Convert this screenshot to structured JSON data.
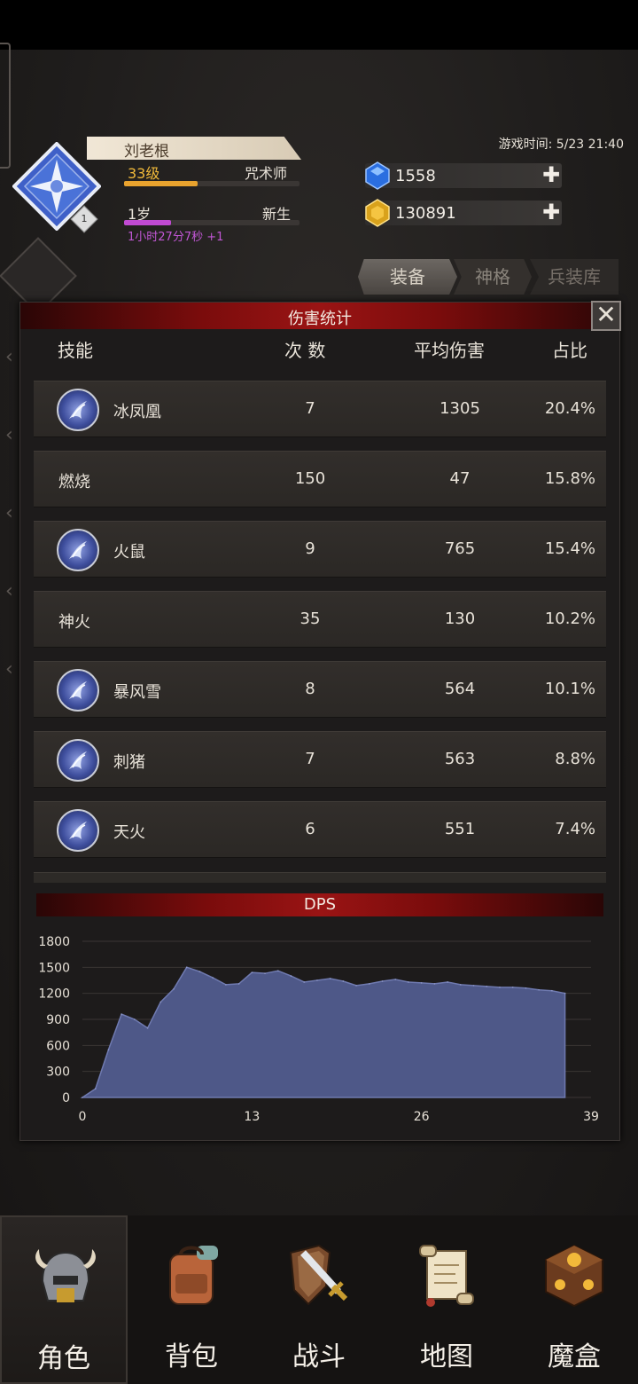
{
  "player": {
    "name": "刘老根",
    "level": "33级",
    "class": "咒术师",
    "age": "1岁",
    "stage": "新生",
    "playtime": "1小时27分7秒 +1",
    "rank_badge": "1",
    "level_progress": 0.42,
    "age_progress": 0.27
  },
  "game_time": "游戏时间: 5/23 21:40",
  "currency": {
    "gems": "1558",
    "gold": "130891"
  },
  "tabs": [
    "装备",
    "神格",
    "兵装库"
  ],
  "modal": {
    "title": "伤害统计",
    "close_icon": "close-icon",
    "columns": [
      "技能",
      "次 数",
      "平均伤害",
      "占比"
    ],
    "rows": [
      {
        "name": "冰凤凰",
        "count": "7",
        "avg": "1305",
        "pct": "20.4%",
        "icon": "ice-phoenix-icon"
      },
      {
        "name": "燃烧",
        "count": "150",
        "avg": "47",
        "pct": "15.8%",
        "icon": ""
      },
      {
        "name": "火鼠",
        "count": "9",
        "avg": "765",
        "pct": "15.4%",
        "icon": "fire-rat-icon"
      },
      {
        "name": "神火",
        "count": "35",
        "avg": "130",
        "pct": "10.2%",
        "icon": ""
      },
      {
        "name": "暴风雪",
        "count": "8",
        "avg": "564",
        "pct": "10.1%",
        "icon": "blizzard-icon"
      },
      {
        "name": "刺猪",
        "count": "7",
        "avg": "563",
        "pct": "8.8%",
        "icon": "spike-boar-icon"
      },
      {
        "name": "天火",
        "count": "6",
        "avg": "551",
        "pct": "7.4%",
        "icon": "sky-fire-icon"
      }
    ],
    "dps_title": "DPS"
  },
  "chart_data": {
    "type": "area",
    "title": "DPS",
    "x": [
      0,
      1,
      2,
      3,
      4,
      5,
      6,
      7,
      8,
      9,
      10,
      11,
      12,
      13,
      14,
      15,
      16,
      17,
      18,
      19,
      20,
      21,
      22,
      23,
      24,
      25,
      26,
      27,
      28,
      29,
      30,
      31,
      32,
      33,
      34,
      35,
      36,
      37
    ],
    "values": [
      0,
      100,
      550,
      960,
      900,
      800,
      1100,
      1250,
      1500,
      1450,
      1380,
      1300,
      1310,
      1440,
      1430,
      1460,
      1400,
      1330,
      1350,
      1370,
      1340,
      1290,
      1310,
      1340,
      1360,
      1330,
      1320,
      1310,
      1330,
      1300,
      1290,
      1280,
      1270,
      1270,
      1260,
      1240,
      1230,
      1200
    ],
    "xticks": [
      0,
      13,
      26,
      39
    ],
    "yticks": [
      0,
      300,
      600,
      900,
      1200,
      1500,
      1800
    ],
    "xlim": [
      0,
      39
    ],
    "ylim": [
      0,
      1800
    ],
    "grid": true,
    "color": "#4e5888"
  },
  "nav": [
    {
      "label": "角色",
      "icon": "helmet-icon",
      "active": true
    },
    {
      "label": "背包",
      "icon": "backpack-icon",
      "active": false
    },
    {
      "label": "战斗",
      "icon": "sword-shield-icon",
      "active": false
    },
    {
      "label": "地图",
      "icon": "scroll-map-icon",
      "active": false
    },
    {
      "label": "魔盒",
      "icon": "magic-box-icon",
      "active": false
    }
  ]
}
